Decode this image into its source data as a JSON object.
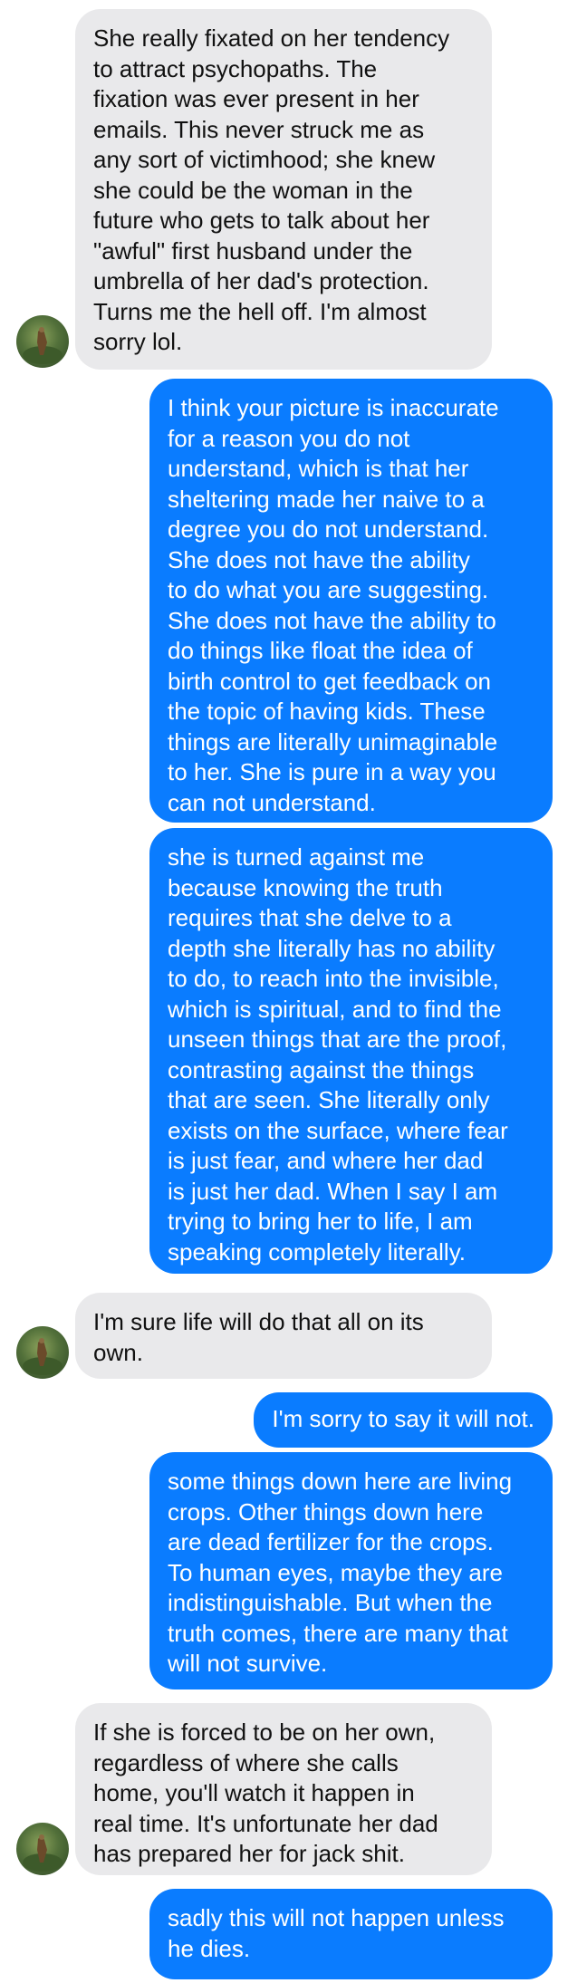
{
  "messages": [
    {
      "id": "m1",
      "direction": "incoming",
      "text": "She really fixated on her tendency\nto attract psychopaths. The\nfixation was ever present in her\nemails. This never struck me as\nany sort of victimhood; she knew\nshe could be the woman in the\nfuture who gets to talk about her\n\"awful\" first husband under the\numbrella of her dad's protection.\nTurns me the hell off. I'm almost\nsorry lol."
    },
    {
      "id": "m2",
      "direction": "outgoing",
      "text": "I think your picture is inaccurate\nfor a reason you do not\nunderstand, which is that her\nsheltering made her naive to a\ndegree you do not understand.\nShe does not have the ability\nto do what you are suggesting.\nShe does not have the ability to\ndo things like float the idea of\nbirth control to get feedback on\nthe topic of having kids. These\nthings are literally unimaginable\nto her. She is pure in a way you\ncan not understand."
    },
    {
      "id": "m3",
      "direction": "outgoing",
      "text": "she is turned against me\nbecause knowing the truth\nrequires that she delve to a\ndepth she literally has no ability\nto do, to reach into the invisible,\nwhich is spiritual, and to find the\nunseen things that are the proof,\ncontrasting against the things\nthat are seen. She literally only\nexists on the surface, where fear\nis just fear, and where her dad\nis just her dad. When I say I am\ntrying to bring her to life, I am\nspeaking completely literally."
    },
    {
      "id": "m4",
      "direction": "incoming",
      "text": "I'm sure life will do that all on its\nown."
    },
    {
      "id": "m5",
      "direction": "outgoing",
      "text": "I'm sorry to say it will not."
    },
    {
      "id": "m6",
      "direction": "outgoing",
      "text": "some things down here are living\ncrops. Other things down here\nare dead fertilizer for the crops.\nTo human eyes, maybe they are\nindistinguishable. But when the\ntruth comes, there are many that\nwill not survive."
    },
    {
      "id": "m7",
      "direction": "incoming",
      "text": "If she is forced to be on her own,\nregardless of where she calls\nhome, you'll watch it happen in\nreal time. It's unfortunate her dad\nhas prepared her for jack shit."
    },
    {
      "id": "m8",
      "direction": "outgoing",
      "text": "sadly this will not happen unless\nhe dies."
    }
  ],
  "colors": {
    "incoming_bubble": "#e9e9eb",
    "outgoing_bubble": "#0a7cff",
    "background": "#ffffff"
  },
  "icons": {
    "contact_avatar": "avatar-icon"
  }
}
